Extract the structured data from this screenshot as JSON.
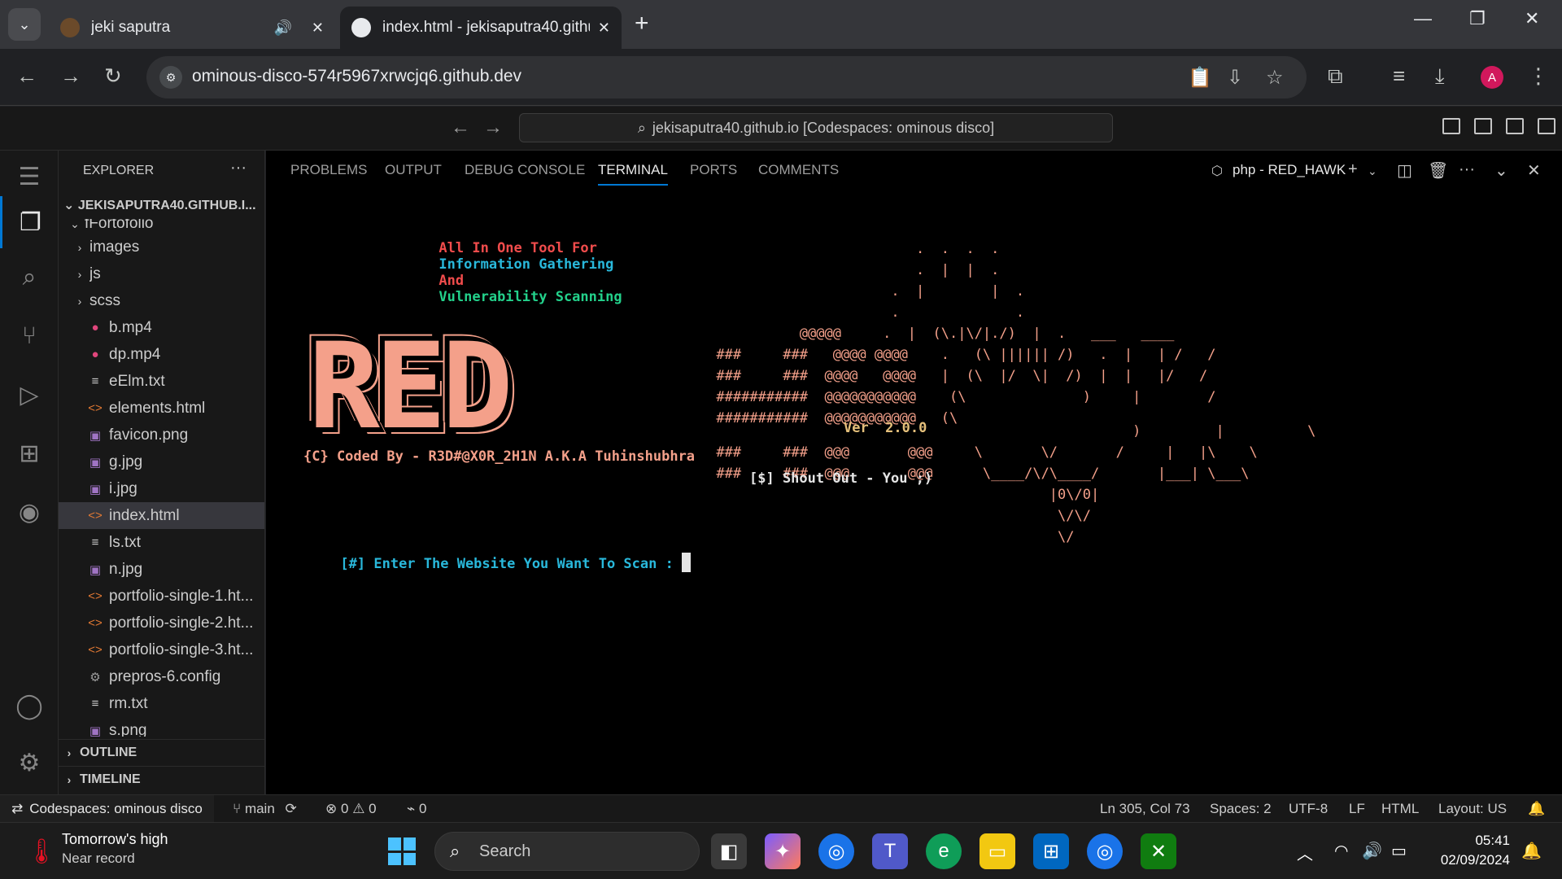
{
  "browser": {
    "tabs": [
      {
        "title": "jeki saputra",
        "active": false
      },
      {
        "title": "index.html - jekisaputra40.githu",
        "active": true
      }
    ],
    "url": "ominous-disco-574r5967xrwcjq6.github.dev",
    "profile_initial": "A"
  },
  "vscode": {
    "command_center": "jekisaputra40.github.io [Codespaces: ominous disco]",
    "explorer": {
      "title": "EXPLORER",
      "root": "JEKISAPUTRA40.GITHUB.I...",
      "folder": "fFortofolio",
      "items": [
        {
          "label": "images",
          "type": "folder",
          "icon": "chevron-right-icon"
        },
        {
          "label": "js",
          "type": "folder",
          "icon": "chevron-right-icon"
        },
        {
          "label": "scss",
          "type": "folder",
          "icon": "chevron-right-icon"
        },
        {
          "label": "b.mp4",
          "type": "video",
          "icon": "video-file-icon"
        },
        {
          "label": "dp.mp4",
          "type": "video",
          "icon": "video-file-icon"
        },
        {
          "label": "eElm.txt",
          "type": "text",
          "icon": "text-file-icon"
        },
        {
          "label": "elements.html",
          "type": "html",
          "icon": "html-file-icon"
        },
        {
          "label": "favicon.png",
          "type": "image",
          "icon": "image-file-icon"
        },
        {
          "label": "g.jpg",
          "type": "image",
          "icon": "image-file-icon"
        },
        {
          "label": "i.jpg",
          "type": "image",
          "icon": "image-file-icon"
        },
        {
          "label": "index.html",
          "type": "html",
          "icon": "html-file-icon",
          "selected": true
        },
        {
          "label": "ls.txt",
          "type": "text",
          "icon": "text-file-icon"
        },
        {
          "label": "n.jpg",
          "type": "image",
          "icon": "image-file-icon"
        },
        {
          "label": "portfolio-single-1.ht...",
          "type": "html",
          "icon": "html-file-icon"
        },
        {
          "label": "portfolio-single-2.ht...",
          "type": "html",
          "icon": "html-file-icon"
        },
        {
          "label": "portfolio-single-3.ht...",
          "type": "html",
          "icon": "html-file-icon"
        },
        {
          "label": "prepros-6.config",
          "type": "config",
          "icon": "gear-file-icon"
        },
        {
          "label": "rm.txt",
          "type": "text",
          "icon": "text-file-icon"
        },
        {
          "label": "s.png",
          "type": "image",
          "icon": "image-file-icon"
        }
      ],
      "outline": "OUTLINE",
      "timeline": "TIMELINE"
    },
    "panel": {
      "tabs": [
        "PROBLEMS",
        "OUTPUT",
        "DEBUG CONSOLE",
        "TERMINAL",
        "PORTS",
        "COMMENTS"
      ],
      "active_tab": "TERMINAL",
      "terminal_name": "php - RED_HAWK"
    },
    "terminal": {
      "headline_1": "All In One Tool For",
      "headline_2": "Information Gathering",
      "headline_3": "And",
      "headline_4": "Vulnerability Scanning",
      "logo_word": "RED",
      "version": "Ver  2.0.0",
      "credit": "{C} Coded By - R3D#@X0R_2H1N A.K.A Tuhinshubhra",
      "shoutout": "[$] Shout Out - You ;)",
      "prompt": "[#] Enter The Website You Want To Scan :"
    },
    "statusbar": {
      "remote": "Codespaces: ominous disco",
      "branch": "main",
      "errors": "0",
      "warnings": "0",
      "ports": "0",
      "position": "Ln 305, Col 73",
      "spaces": "Spaces: 2",
      "encoding": "UTF-8",
      "eol": "LF",
      "language": "HTML",
      "layout": "Layout: US"
    }
  },
  "taskbar": {
    "weather_line1": "Tomorrow's high",
    "weather_line2": "Near record",
    "search_placeholder": "Search",
    "time": "05:41",
    "date": "02/09/2024"
  }
}
